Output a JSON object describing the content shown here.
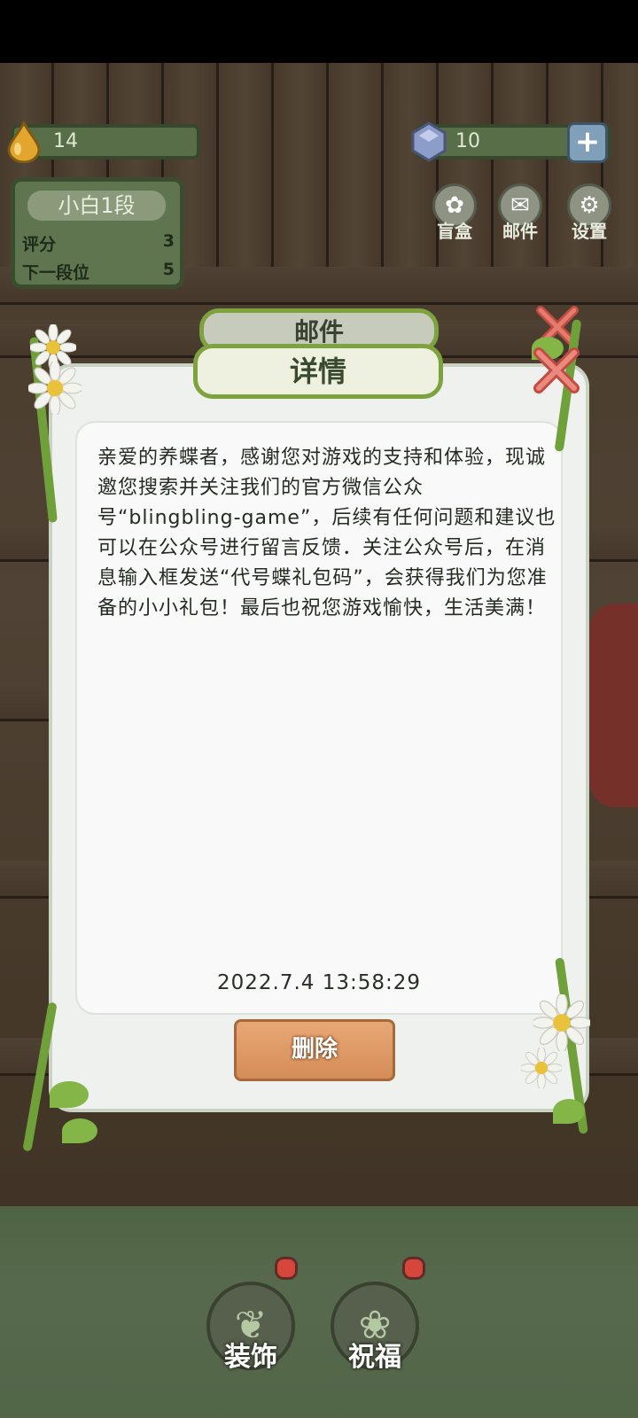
{
  "hud": {
    "water_count": "14",
    "gem_count": "10",
    "plus_symbol": "+"
  },
  "rank": {
    "title": "小白1段",
    "score_label": "评分",
    "score_value": "3",
    "next_label": "下一段位",
    "next_value": "5"
  },
  "top_buttons": {
    "blindbox": "盲盒",
    "mail": "邮件",
    "settings": "设置"
  },
  "dialog": {
    "tab_title": "邮件",
    "title": "详情",
    "message": "亲爱的养蝶者，感谢您对游戏的支持和体验，现诚邀您搜索并关注我们的官方微信公众号“blingbling-game”，后续有任何问题和建议也可以在公众号进行留言反馈．关注公众号后，在消息输入框发送“代号蝶礼包码”，会获得我们为您准备的小小礼包！最后也祝您游戏愉快，生活美满！",
    "timestamp": "2022.7.4 13:58:29",
    "delete_label": "删除"
  },
  "bottom_buttons": {
    "decorate": "装饰",
    "blessing": "祝福"
  },
  "colors": {
    "vine_green": "#6fa03a",
    "delete_orange": "#d58c57",
    "close_red": "#e0574b"
  },
  "icons": [
    "water-drop-icon",
    "gem-icon",
    "plus-icon",
    "blindbox-icon",
    "mail-icon",
    "settings-icon",
    "close-icon",
    "daisy-icon",
    "plant-icon",
    "butterfly-icon"
  ]
}
